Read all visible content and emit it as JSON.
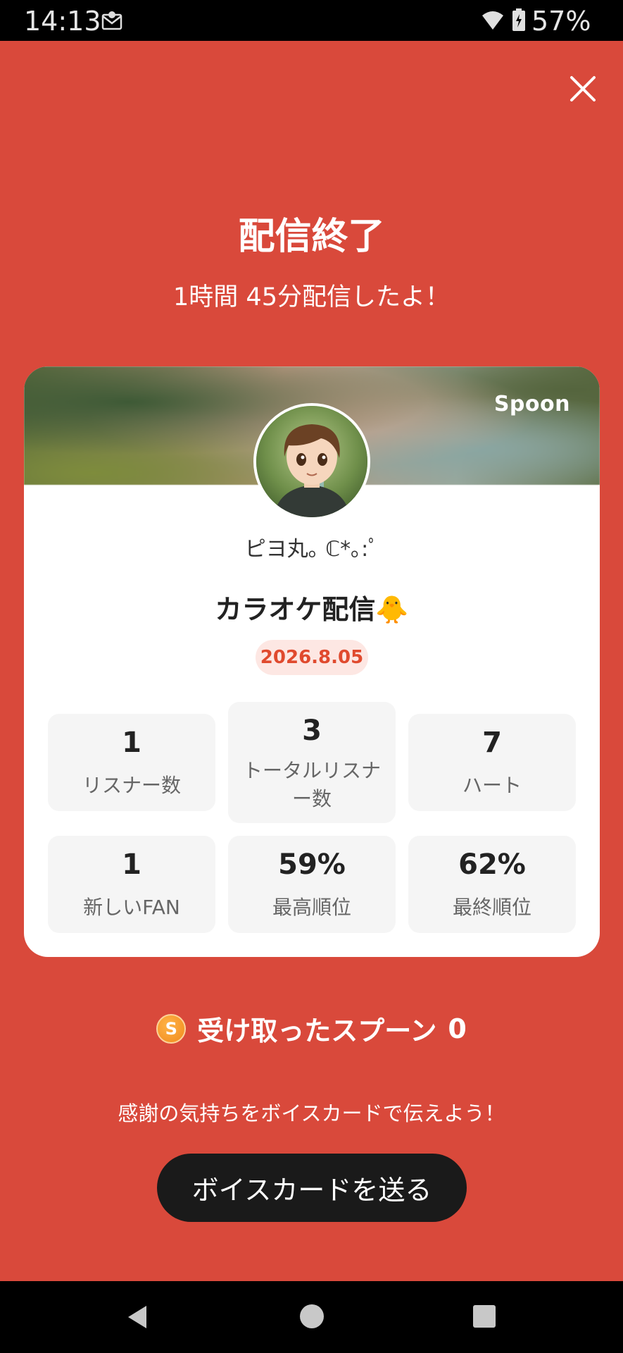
{
  "status_bar": {
    "time": "14:13",
    "battery_percent": "57%"
  },
  "header": {
    "title": "配信終了",
    "subtitle": "1時間 45分配信したよ！"
  },
  "card": {
    "brand": "Spoon",
    "username": "ピヨ丸｡ ℂ*｡:ﾟ",
    "live_title": "カラオケ配信🐥",
    "date": "2026.8.05",
    "stats": [
      {
        "value": "1",
        "label": "リスナー数"
      },
      {
        "value": "3",
        "label": "トータルリスナー数"
      },
      {
        "value": "7",
        "label": "ハート"
      },
      {
        "value": "1",
        "label": "新しいFAN"
      },
      {
        "value": "59%",
        "label": "最高順位"
      },
      {
        "value": "62%",
        "label": "最終順位"
      }
    ]
  },
  "spoons": {
    "coin_symbol": "S",
    "label": "受け取ったスプーン",
    "count": "0"
  },
  "thanks_message": "感謝の気持ちをボイスカードで伝えよう！",
  "voice_card_button": "ボイスカードを送る",
  "colors": {
    "background": "#d9493b",
    "badge_text": "#e04a2e",
    "button_bg": "#1a1a1a"
  }
}
